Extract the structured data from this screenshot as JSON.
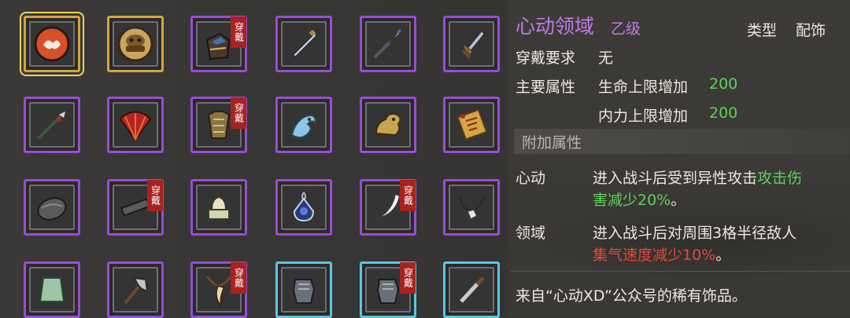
{
  "inventory": {
    "tag_label": "穿戴",
    "slots": [
      {
        "icon": "coin-pouch-icon",
        "rarity": "gold",
        "selected": true,
        "equipped": false
      },
      {
        "icon": "ornate-medallion-icon",
        "rarity": "gold",
        "selected": false,
        "equipped": false
      },
      {
        "icon": "blue-gauntlet-icon",
        "rarity": "purple",
        "selected": false,
        "equipped": true
      },
      {
        "icon": "long-sword-icon",
        "rarity": "purple",
        "selected": false,
        "equipped": false
      },
      {
        "icon": "spear-icon",
        "rarity": "purple",
        "selected": false,
        "equipped": false
      },
      {
        "icon": "broad-sword-icon",
        "rarity": "purple",
        "selected": false,
        "equipped": false
      },
      {
        "icon": "green-glaive-icon",
        "rarity": "purple",
        "selected": false,
        "equipped": false
      },
      {
        "icon": "red-fan-icon",
        "rarity": "purple",
        "selected": false,
        "equipped": false
      },
      {
        "icon": "gold-armor-icon",
        "rarity": "purple",
        "selected": false,
        "equipped": true
      },
      {
        "icon": "ice-dragon-icon",
        "rarity": "purple",
        "selected": false,
        "equipped": false
      },
      {
        "icon": "gold-beast-icon",
        "rarity": "purple",
        "selected": false,
        "equipped": false
      },
      {
        "icon": "talisman-scroll-icon",
        "rarity": "purple",
        "selected": false,
        "equipped": false
      },
      {
        "icon": "iron-helmet-icon",
        "rarity": "purple",
        "selected": false,
        "equipped": false
      },
      {
        "icon": "iron-bar-icon",
        "rarity": "purple",
        "selected": false,
        "equipped": true
      },
      {
        "icon": "jade-seal-icon",
        "rarity": "purple",
        "selected": false,
        "equipped": false
      },
      {
        "icon": "blue-amulet-icon",
        "rarity": "purple",
        "selected": false,
        "equipped": false
      },
      {
        "icon": "white-fang-icon",
        "rarity": "purple",
        "selected": false,
        "equipped": true
      },
      {
        "icon": "pendant-necklace-icon",
        "rarity": "purple",
        "selected": false,
        "equipped": false
      },
      {
        "icon": "jade-cloak-icon",
        "rarity": "purple",
        "selected": false,
        "equipped": false
      },
      {
        "icon": "battle-axe-icon",
        "rarity": "purple",
        "selected": false,
        "equipped": false
      },
      {
        "icon": "horn-necklace-icon",
        "rarity": "purple",
        "selected": false,
        "equipped": true
      },
      {
        "icon": "steel-gauntlet-icon",
        "rarity": "cyan",
        "selected": false,
        "equipped": false
      },
      {
        "icon": "steel-gauntlet-icon",
        "rarity": "cyan",
        "selected": false,
        "equipped": true
      },
      {
        "icon": "short-sword-icon",
        "rarity": "cyan",
        "selected": false,
        "equipped": false
      }
    ]
  },
  "detail": {
    "name": "心动领域",
    "grade": "乙级",
    "type_label": "类型",
    "type_value": "配饰",
    "requirement_label": "穿戴要求",
    "requirement_value": "无",
    "main_attr_label": "主要属性",
    "main_attrs": [
      {
        "text": "生命上限增加",
        "value": "200"
      },
      {
        "text": "内力上限增加",
        "value": "200"
      }
    ],
    "extra_attr_header": "附加属性",
    "extras": [
      {
        "name": "心动",
        "line1": "进入战斗后受到异性攻击",
        "line1_green": "攻击伤",
        "line2_green": "害减少20%",
        "line2_rest": "。"
      },
      {
        "name": "领域",
        "line1": "进入战斗后对周围3格半径敌人",
        "line2_red": "集气速度减少10%",
        "line2_rest": "。"
      }
    ],
    "flavor_text": "来自“心动XD”公众号的稀有饰品。"
  },
  "colors": {
    "gold_frame": "#d6a43d",
    "purple_frame": "#9a4cd6",
    "cyan_frame": "#57c8e3",
    "item_name": "#c27ae8",
    "positive": "#5dd25a",
    "negative": "#e1473d"
  }
}
